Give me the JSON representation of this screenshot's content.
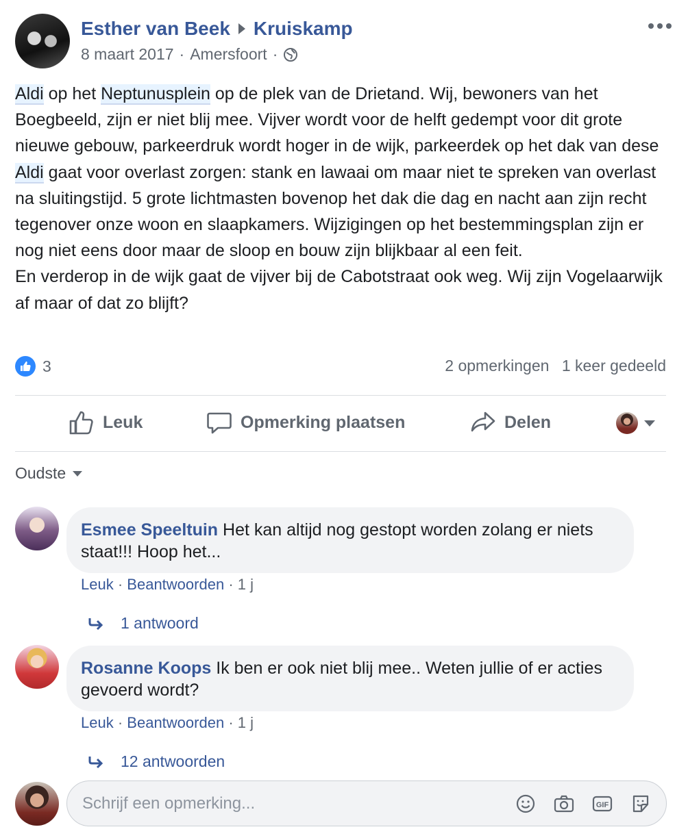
{
  "post": {
    "author": "Esther van Beek",
    "group": "Kruiskamp",
    "date": "8 maart 2017",
    "location": "Amersfoort",
    "text_parts": [
      {
        "t": "Aldi",
        "tag": true
      },
      {
        "t": " op het ",
        "tag": false
      },
      {
        "t": "Neptunusplein",
        "tag": true
      },
      {
        "t": " op de plek van de Drietand. Wij, bewoners van het Boegbeeld, zijn er niet blij mee. Vijver wordt voor de helft gedempt voor dit grote nieuwe gebouw, parkeerdruk wordt hoger in de wijk, parkeerdek op het dak van dese ",
        "tag": false
      },
      {
        "t": "Aldi",
        "tag": true
      },
      {
        "t": " gaat voor overlast zorgen: stank en lawaai om maar niet te spreken van overlast na sluitingstijd. 5 grote lichtmasten bovenop het dak die dag en nacht aan zijn recht tegenover onze woon en slaapkamers. Wijzigingen op het bestemmingsplan zijn er nog niet eens door maar de sloop en bouw zijn blijkbaar al een feit.\nEn verderop in de wijk gaat de vijver bij de Cabotstraat ook weg. Wij zijn Vogelaarwijk af maar of dat zo blijft?",
        "tag": false
      }
    ],
    "like_count": "3",
    "comments_count": "2 opmerkingen",
    "shares_count": "1 keer gedeeld"
  },
  "actions": {
    "like": "Leuk",
    "comment": "Opmerking plaatsen",
    "share": "Delen"
  },
  "sort_label": "Oudste",
  "comments": [
    {
      "author": "Esmee Speeltuin",
      "text": "Het kan altijd nog gestopt worden zolang er niets staat!!! Hoop het...",
      "like": "Leuk",
      "reply": "Beantwoorden",
      "time": "1 j",
      "replies": "1 antwoord"
    },
    {
      "author": "Rosanne Koops",
      "text": "Ik ben er ook niet blij mee.. Weten jullie of er acties gevoerd wordt?",
      "like": "Leuk",
      "reply": "Beantwoorden",
      "time": "1 j",
      "replies": "12 antwoorden"
    }
  ],
  "composer": {
    "placeholder": "Schrijf een opmerking...",
    "gif_label": "GIF"
  },
  "icons": [
    "globe-icon",
    "more-icon",
    "like-icon",
    "comment-icon",
    "share-icon",
    "reply-arrow-icon",
    "emoji-icon",
    "camera-icon",
    "gif-icon",
    "sticker-icon"
  ],
  "colors": {
    "link": "#385898",
    "muted": "#606770",
    "like_blue": "#2d88ff",
    "bubble_bg": "#f2f3f5"
  }
}
